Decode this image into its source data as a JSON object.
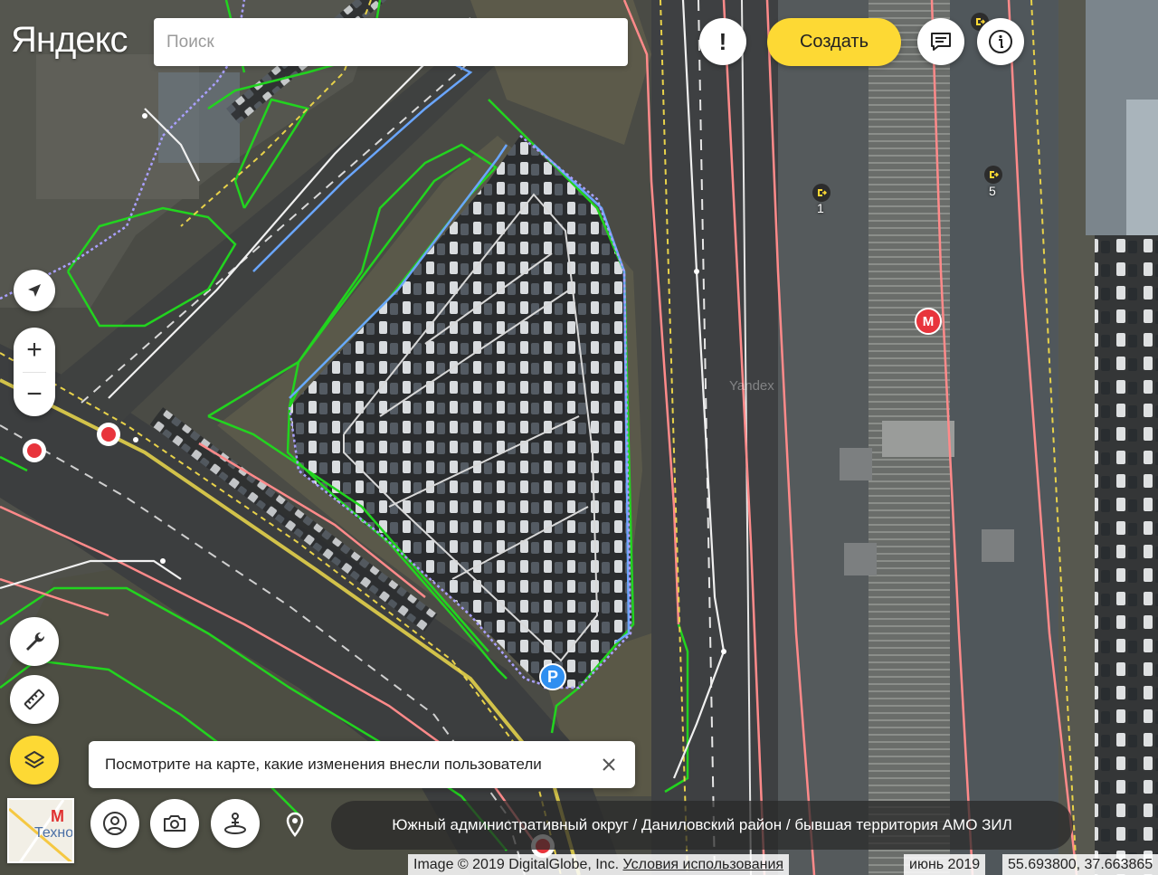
{
  "header": {
    "logo": "Яндекс",
    "search_placeholder": "Поиск",
    "create_label": "Создать"
  },
  "icons": {
    "alert": "exclamation-icon",
    "feedback": "chat-icon",
    "info": "info-icon",
    "locate": "location-arrow-icon",
    "tools": "wrench-icon",
    "ruler": "ruler-icon",
    "layers": "layers-icon",
    "user": "user-icon",
    "photo": "camera-icon",
    "panorama": "panorama-icon",
    "pin": "pin-icon"
  },
  "controls": {
    "zoom_in": "+",
    "zoom_out": "−"
  },
  "tooltip": {
    "text": "Посмотрите на карте, какие изменения внесли пользователи"
  },
  "minimap": {
    "metro": "М",
    "label": "Техно"
  },
  "breadcrumb": "Южный административный округ / Даниловский район / бывшая территория АМО ЗИЛ",
  "attribution": {
    "image": "Image © 2019 DigitalGlobe, Inc.",
    "terms": "Условия использования",
    "date": "июнь 2019",
    "coords": "55.693800, 37.663865"
  },
  "map_labels": {
    "exit1": "1",
    "exit5": "5",
    "metro": "М",
    "parking": "P",
    "watermark": "Yandex"
  },
  "colors": {
    "accent_yellow": "#fdd934",
    "metro_red": "#e8343c",
    "parking_blue": "#2f8ff0",
    "edit_green": "#22d41f",
    "edit_pink": "#ff8a8a",
    "edit_blue": "#6aa6ff"
  }
}
